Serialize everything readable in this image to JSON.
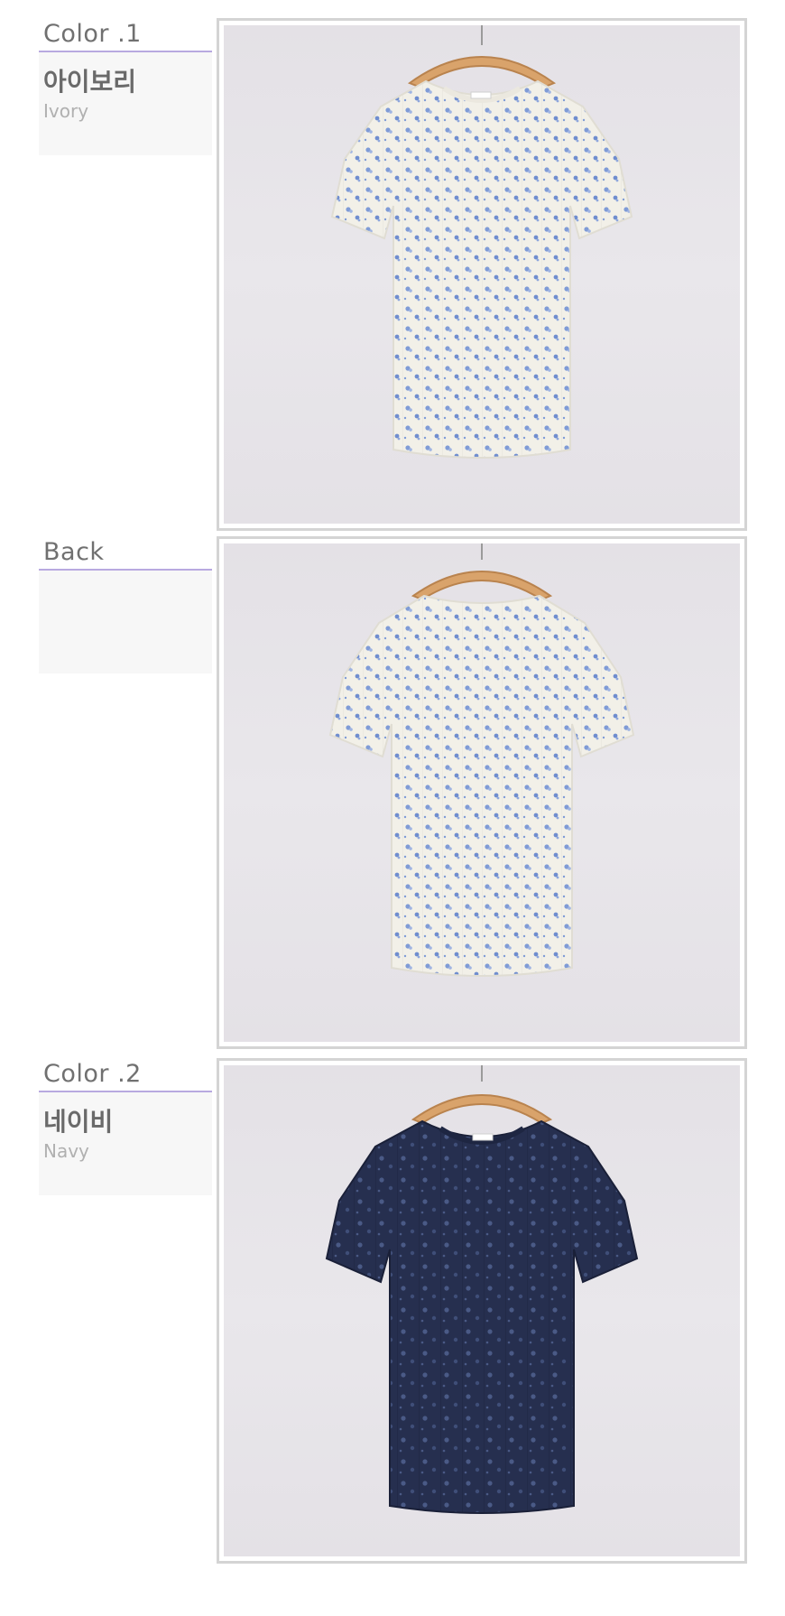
{
  "sections": [
    {
      "heading": "Color .1",
      "name_ko": "아이보리",
      "name_en": "Ivory",
      "photo_alt": "ivory-floral-tee-front"
    },
    {
      "heading": "Back",
      "name_ko": "",
      "name_en": "",
      "photo_alt": "ivory-floral-tee-back"
    },
    {
      "heading": "Color .2",
      "name_ko": "네이비",
      "name_en": "Navy",
      "photo_alt": "navy-floral-tee-front"
    }
  ],
  "colors": {
    "accent_line": "#b8a9e0",
    "heading_text": "#707070",
    "ivory_fabric": "#f2f0e8",
    "ivory_flower": "#7f9bd6",
    "navy_fabric": "#262f4f",
    "navy_flower": "#4a5a86",
    "hanger_wood": "#d9a36b",
    "backdrop": "#e6e3e8"
  },
  "icons": [
    "hanger-icon",
    "t-shirt-icon"
  ]
}
